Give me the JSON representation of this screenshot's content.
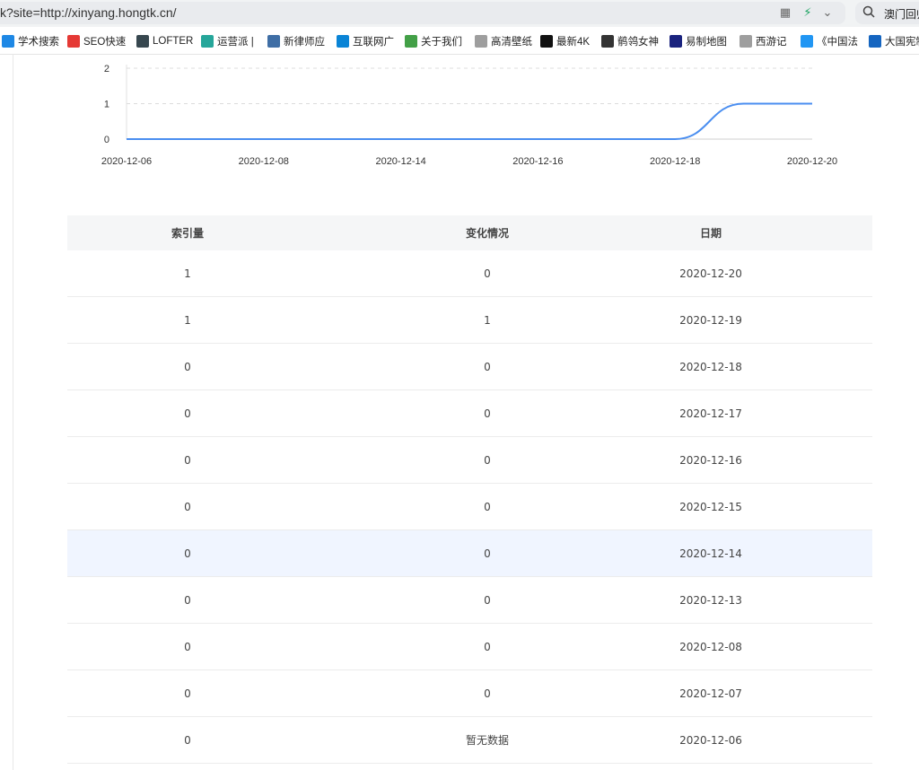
{
  "browser": {
    "address": "k?site=http://xinyang.hongtk.cn/",
    "search_text": "澳门回归"
  },
  "bookmarks": [
    {
      "label": "学术搜索",
      "icon": "ie-icon",
      "color": "#1e88e5"
    },
    {
      "label": "SEO快速",
      "icon": "seo-wave-icon",
      "color": "#e53935"
    },
    {
      "label": "LOFTER",
      "icon": "lofter-icon",
      "color": "#37474f"
    },
    {
      "label": "运营派 |",
      "icon": "android-icon",
      "color": "#26a69a"
    },
    {
      "label": "新律师应",
      "icon": "wordpress-icon",
      "color": "#3f6ea5"
    },
    {
      "label": "互联网广",
      "icon": "page-icon",
      "color": "#0a84d6"
    },
    {
      "label": "关于我们",
      "icon": "flag-icon",
      "color": "#43a047"
    },
    {
      "label": "高清壁纸",
      "icon": "doc-icon",
      "color": "#9e9e9e"
    },
    {
      "label": "最新4K",
      "icon": "4k-icon",
      "color": "#111111"
    },
    {
      "label": "鹡鸰女神",
      "icon": "bird-icon",
      "color": "#333333"
    },
    {
      "label": "易制地图",
      "icon": "map-icon",
      "color": "#1a237e"
    },
    {
      "label": "西游记",
      "icon": "doc-icon",
      "color": "#9e9e9e"
    },
    {
      "label": "《中国法",
      "icon": "play-icon",
      "color": "#2196f3"
    },
    {
      "label": "大国宪制",
      "icon": "globe-icon",
      "color": "#1565c0"
    }
  ],
  "chart_data": {
    "type": "line",
    "x": [
      "2020-12-06",
      "2020-12-07",
      "2020-12-08",
      "2020-12-13",
      "2020-12-14",
      "2020-12-15",
      "2020-12-16",
      "2020-12-17",
      "2020-12-18",
      "2020-12-19",
      "2020-12-20"
    ],
    "x_tick_labels": [
      "2020-12-06",
      "2020-12-08",
      "2020-12-14",
      "2020-12-16",
      "2020-12-18",
      "2020-12-20"
    ],
    "series": [
      {
        "values": [
          0,
          0,
          0,
          0,
          0,
          0,
          0,
          0,
          0,
          1,
          1
        ]
      }
    ],
    "y_ticks": [
      0,
      1,
      2
    ],
    "ylim": [
      0,
      2
    ],
    "grid": true,
    "line_color": "#4a8ef0"
  },
  "table": {
    "headers": [
      "索引量",
      "变化情况",
      "日期"
    ],
    "rows": [
      {
        "index": "1",
        "change": "0",
        "date": "2020-12-20"
      },
      {
        "index": "1",
        "change": "1",
        "date": "2020-12-19"
      },
      {
        "index": "0",
        "change": "0",
        "date": "2020-12-18"
      },
      {
        "index": "0",
        "change": "0",
        "date": "2020-12-17"
      },
      {
        "index": "0",
        "change": "0",
        "date": "2020-12-16"
      },
      {
        "index": "0",
        "change": "0",
        "date": "2020-12-15"
      },
      {
        "index": "0",
        "change": "0",
        "date": "2020-12-14"
      },
      {
        "index": "0",
        "change": "0",
        "date": "2020-12-13"
      },
      {
        "index": "0",
        "change": "0",
        "date": "2020-12-08"
      },
      {
        "index": "0",
        "change": "0",
        "date": "2020-12-07"
      },
      {
        "index": "0",
        "change": "暂无数据",
        "date": "2020-12-06"
      }
    ],
    "highlight_row": 6
  }
}
